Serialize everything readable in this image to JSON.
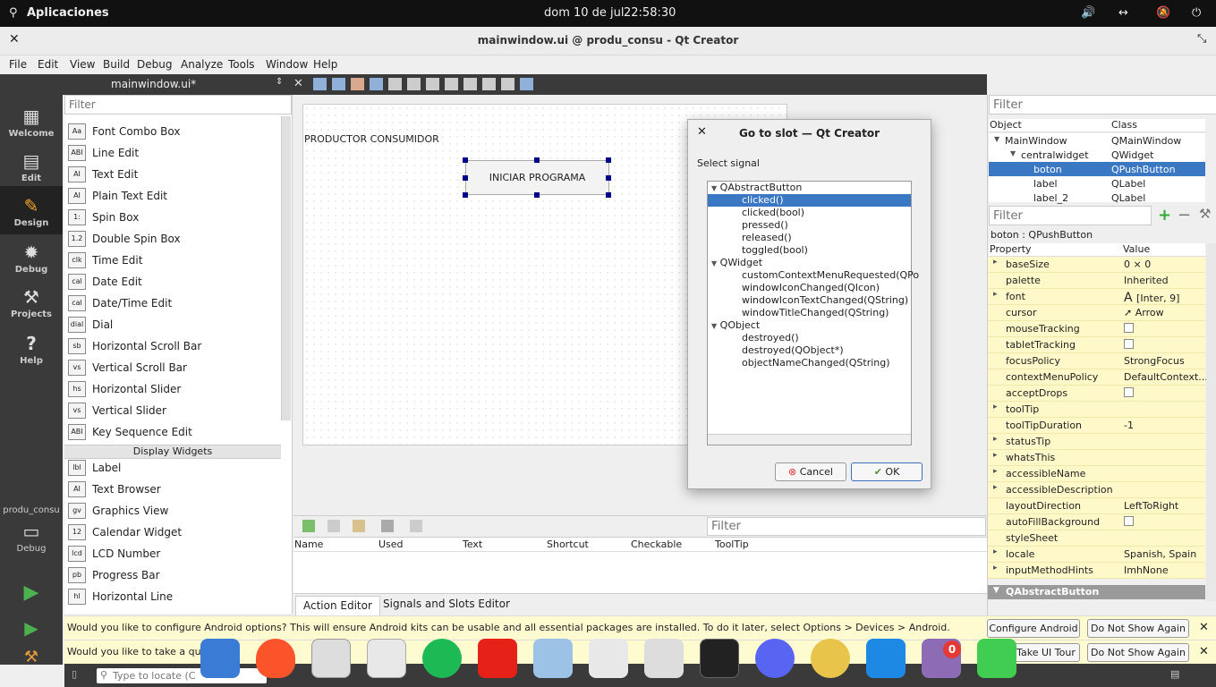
{
  "topbar": {
    "apps": "Aplicaciones",
    "date": "dom 10 de jul",
    "time": "22:58:30"
  },
  "window": {
    "title": "mainwindow.ui @ produ_consu - Qt Creator"
  },
  "menu": [
    "File",
    "Edit",
    "View",
    "Build",
    "Debug",
    "Analyze",
    "Tools",
    "Window",
    "Help"
  ],
  "editor": {
    "file": "mainwindow.ui*"
  },
  "modes": [
    "Welcome",
    "Edit",
    "Design",
    "Debug",
    "Projects",
    "Help"
  ],
  "kit": {
    "project": "produ_consu",
    "mode": "Debug"
  },
  "widgetbox": {
    "filter_placeholder": "Filter",
    "items": [
      "Font Combo Box",
      "Line Edit",
      "Text Edit",
      "Plain Text Edit",
      "Spin Box",
      "Double Spin Box",
      "Time Edit",
      "Date Edit",
      "Date/Time Edit",
      "Dial",
      "Horizontal Scroll Bar",
      "Vertical Scroll Bar",
      "Horizontal Slider",
      "Vertical Slider",
      "Key Sequence Edit"
    ],
    "section": "Display Widgets",
    "items2": [
      "Label",
      "Text Browser",
      "Graphics View",
      "Calendar Widget",
      "LCD Number",
      "Progress Bar",
      "Horizontal Line"
    ],
    "icons": [
      "Aa",
      "ABI",
      "AI",
      "AI",
      "1:",
      "1.2",
      "clk",
      "cal",
      "cal",
      "dial",
      "sb",
      "vs",
      "hs",
      "vs",
      "ABI",
      "lbl",
      "AI",
      "gv",
      "12",
      "lcd",
      "pb",
      "hl"
    ]
  },
  "form": {
    "label": "PRODUCTOR CONSUMIDOR",
    "button": "INICIAR PROGRAMA"
  },
  "dialog": {
    "title": "Go to slot — Qt Creator",
    "prompt": "Select signal",
    "groups": [
      {
        "name": "QAbstractButton",
        "signals": [
          "clicked()",
          "clicked(bool)",
          "pressed()",
          "released()",
          "toggled(bool)"
        ]
      },
      {
        "name": "QWidget",
        "signals": [
          "customContextMenuRequested(QPo",
          "windowIconChanged(QIcon)",
          "windowIconTextChanged(QString)",
          "windowTitleChanged(QString)"
        ]
      },
      {
        "name": "QObject",
        "signals": [
          "destroyed()",
          "destroyed(QObject*)",
          "objectNameChanged(QString)"
        ]
      }
    ],
    "cancel": "Cancel",
    "ok": "OK"
  },
  "actions": {
    "filter_placeholder": "Filter",
    "columns": [
      "Name",
      "Used",
      "Text",
      "Shortcut",
      "Checkable",
      "ToolTip"
    ],
    "tabs": [
      "Action Editor",
      "Signals and Slots Editor"
    ]
  },
  "objects": {
    "filter_placeholder": "Filter",
    "headers": [
      "Object",
      "Class"
    ],
    "rows": [
      [
        "MainWindow",
        "QMainWindow"
      ],
      [
        "centralwidget",
        "QWidget"
      ],
      [
        "boton",
        "QPushButton"
      ],
      [
        "label",
        "QLabel"
      ],
      [
        "label_2",
        "QLabel"
      ]
    ]
  },
  "props": {
    "filter_placeholder": "Filter",
    "selected": "boton : QPushButton",
    "headers": [
      "Property",
      "Value"
    ],
    "rows": [
      [
        "baseSize",
        "0 × 0"
      ],
      [
        "palette",
        "Inherited"
      ],
      [
        "font",
        "[Inter, 9]"
      ],
      [
        "cursor",
        "Arrow"
      ],
      [
        "mouseTracking",
        ""
      ],
      [
        "tabletTracking",
        ""
      ],
      [
        "focusPolicy",
        "StrongFocus"
      ],
      [
        "contextMenuPolicy",
        "DefaultContext..."
      ],
      [
        "acceptDrops",
        ""
      ],
      [
        "toolTip",
        ""
      ],
      [
        "toolTipDuration",
        "-1"
      ],
      [
        "statusTip",
        ""
      ],
      [
        "whatsThis",
        ""
      ],
      [
        "accessibleName",
        ""
      ],
      [
        "accessibleDescription",
        ""
      ],
      [
        "layoutDirection",
        "LeftToRight"
      ],
      [
        "autoFillBackground",
        ""
      ],
      [
        "styleSheet",
        ""
      ],
      [
        "locale",
        "Spanish, Spain"
      ],
      [
        "inputMethodHints",
        "ImhNone"
      ]
    ],
    "section": "QAbstractButton"
  },
  "notices": [
    {
      "text": "Would you like to configure Android options? This will ensure Android kits can be usable and all essential packages are installed. To do it later, select Options > Devices > Android.",
      "b1": "Configure Android",
      "b2": "Do Not Show Again"
    },
    {
      "text": "Would you like to take a quick",
      "b1": "Take UI Tour",
      "b2": "Do Not Show Again"
    }
  ],
  "locator": {
    "placeholder": "Type to locate (C"
  },
  "notif_count": "0"
}
